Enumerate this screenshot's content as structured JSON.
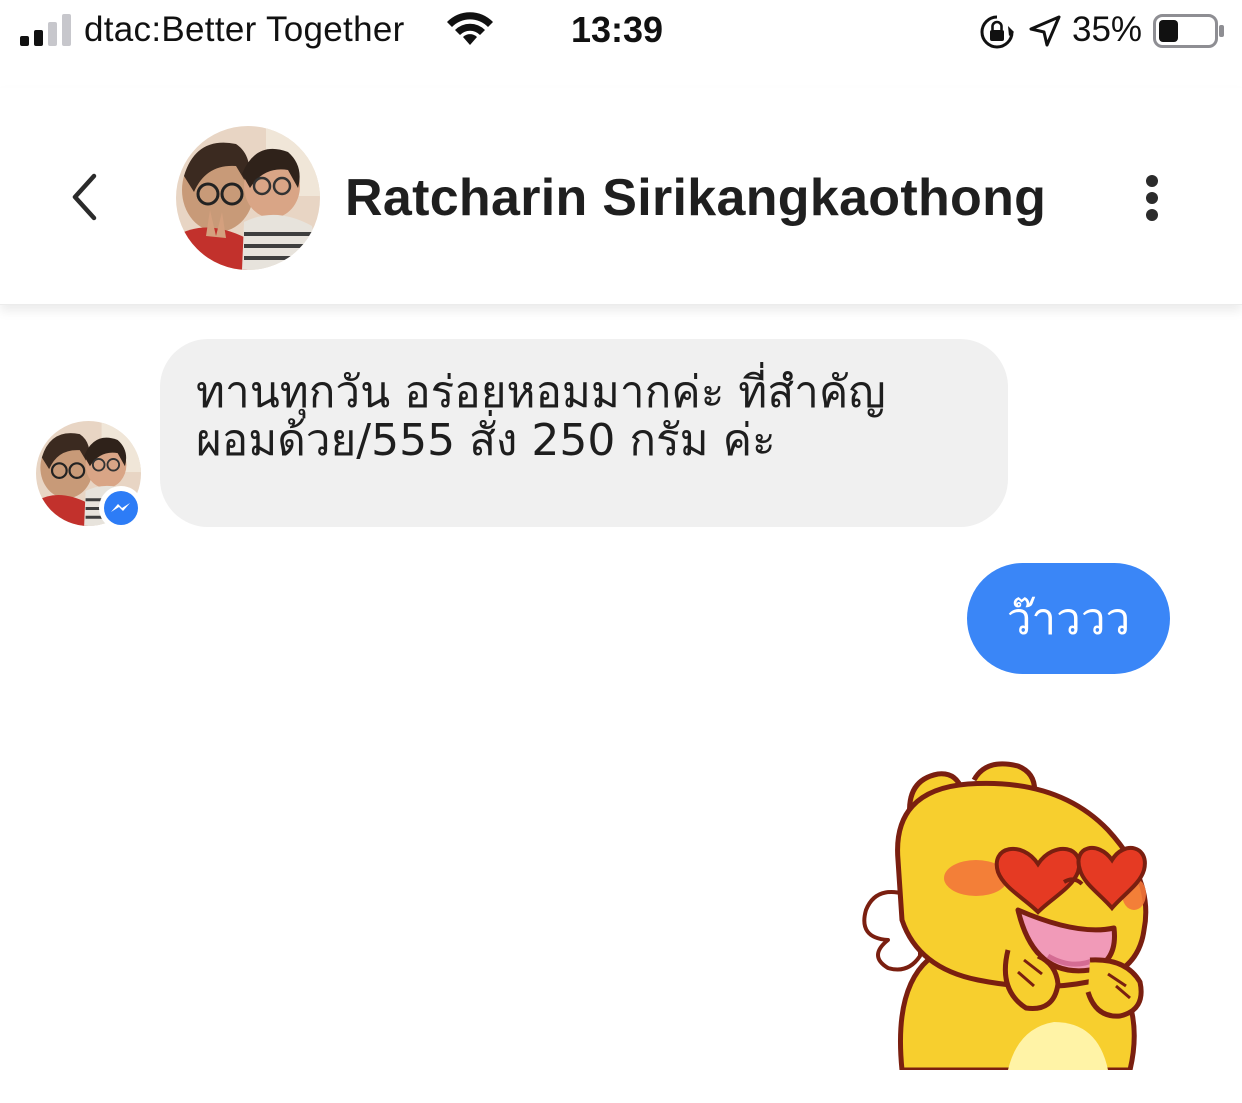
{
  "status_bar": {
    "carrier": "dtac:Better Together",
    "time": "13:39",
    "battery_percent": "35%",
    "signal_bars_active": 2,
    "signal_bars_total": 4,
    "battery_level": 0.35,
    "icons": [
      "signal-icon",
      "wifi-icon",
      "orientation-lock-icon",
      "location-arrow-icon",
      "battery-icon"
    ]
  },
  "header": {
    "contact_name": "Ratcharin Sirikangkaothong",
    "icons": [
      "back-chevron-icon",
      "avatar",
      "more-vertical-icon"
    ]
  },
  "messages": [
    {
      "direction": "incoming",
      "lines": [
        "ทานทุกวัน  อร่อยหอมมากค่ะ  ที่สำคัญ",
        "ผอมด้วย/555  สั่ง 250 กรัม ค่ะ"
      ]
    },
    {
      "direction": "outgoing",
      "text": "ว๊าววว"
    },
    {
      "direction": "outgoing",
      "type": "sticker",
      "sticker": "heart-eyes-creature-sticker"
    }
  ],
  "colors": {
    "outgoing_bubble": "#3a86f7",
    "incoming_bubble": "#f0f0f0",
    "messenger_badge": "#2d7cf6"
  }
}
